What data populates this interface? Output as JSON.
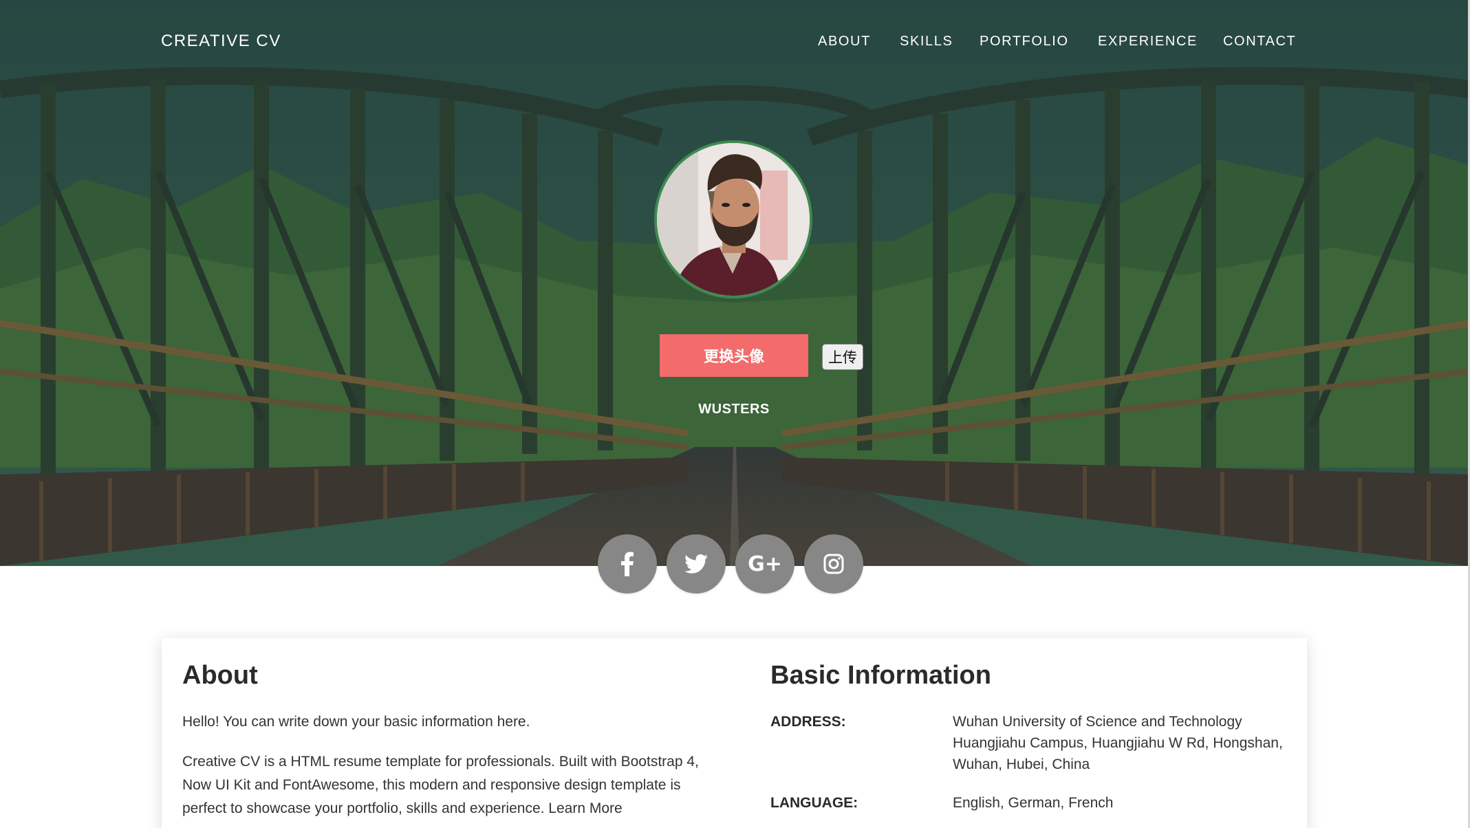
{
  "header": {
    "brand": "CREATIVE CV",
    "nav": [
      "ABOUT",
      "SKILLS",
      "PORTFOLIO",
      "EXPERIENCE",
      "CONTACT"
    ]
  },
  "profile": {
    "change_avatar_label": "更换头像",
    "upload_label": "上传",
    "name": "WUSTERS"
  },
  "social": [
    {
      "icon": "facebook-icon",
      "glyph": "f"
    },
    {
      "icon": "twitter-icon",
      "glyph": ""
    },
    {
      "icon": "google-plus-icon",
      "glyph": "G+"
    },
    {
      "icon": "instagram-icon",
      "glyph": ""
    }
  ],
  "about": {
    "title": "About",
    "p1": "Hello! You can write down your basic information here.",
    "p2": "Creative CV is a HTML resume template for professionals. Built with Bootstrap 4, Now UI Kit and FontAwesome, this modern and responsive design template is perfect to showcase your portfolio, skills",
    "p2_cut": "and experience. Learn More"
  },
  "basic_info": {
    "title": "Basic Information",
    "rows": [
      {
        "label": "ADDRESS:",
        "value": "Wuhan University of Science and Technology Huangjiahu Campus, Huangjiahu W Rd, Hongshan, Wuhan, Hubei, China"
      },
      {
        "label": "LANGUAGE:",
        "value": "English, German, French"
      }
    ]
  },
  "colors": {
    "accent_button": "#f36b6b",
    "social_circle": "#878787",
    "avatar_ring": "#3f8a4f",
    "link": "#2e8b3a"
  }
}
